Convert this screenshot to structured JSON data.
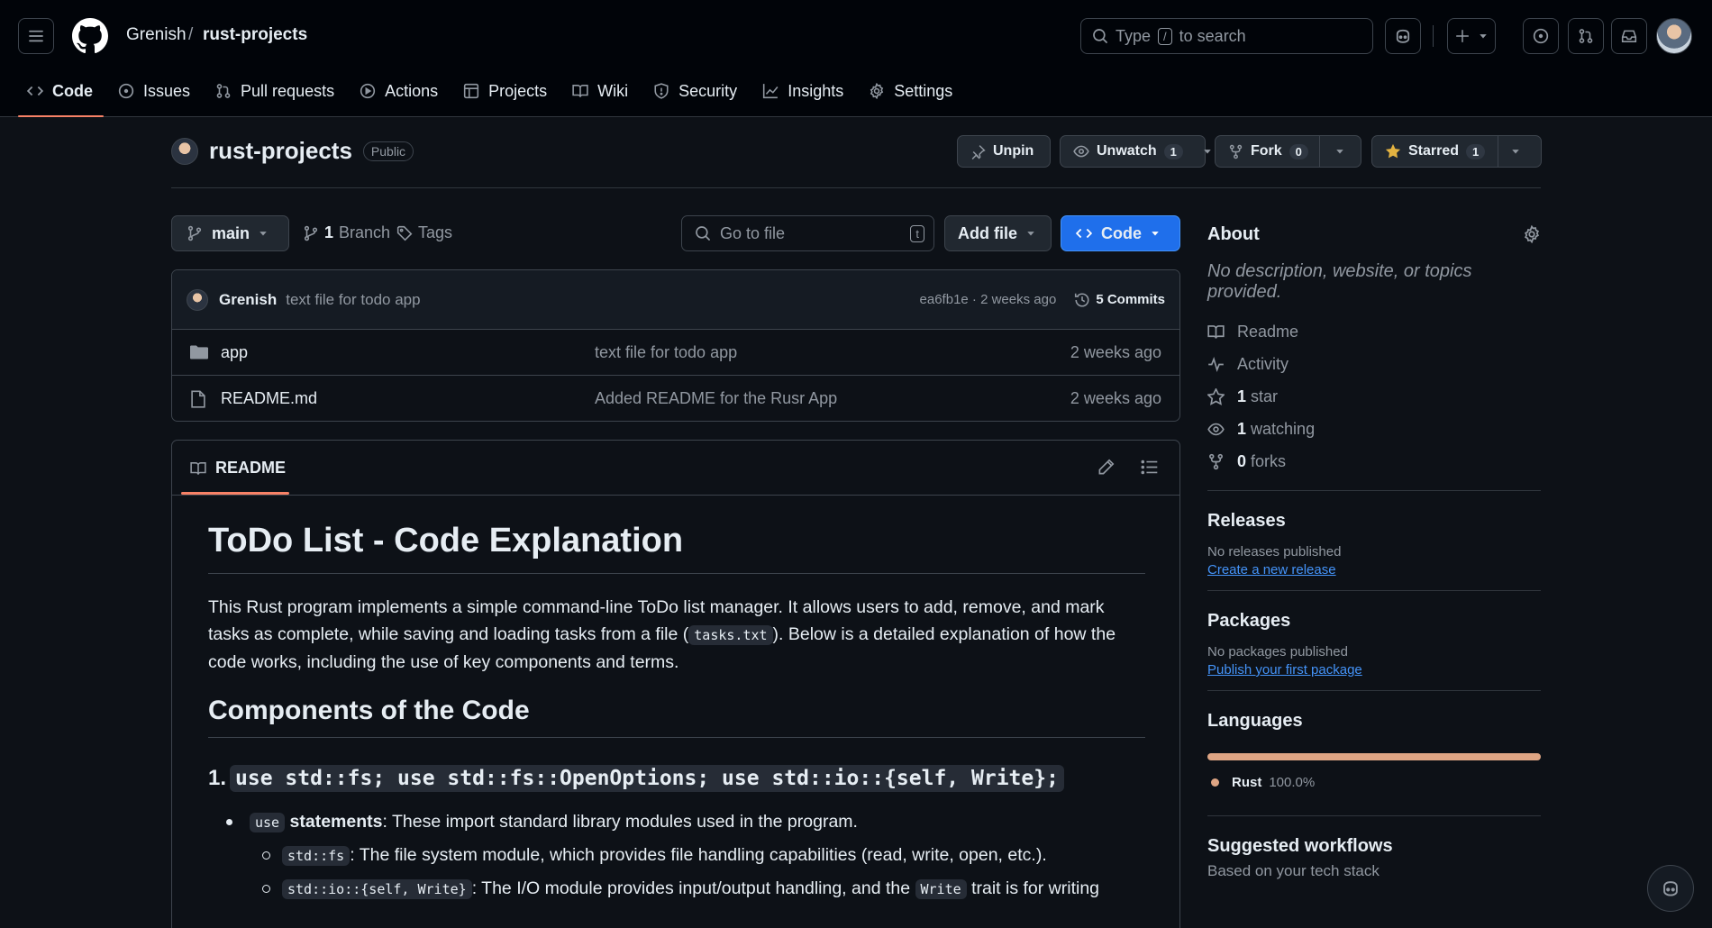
{
  "breadcrumb": {
    "owner": "Grenish",
    "separator": "/",
    "repo": "rust-projects"
  },
  "search": {
    "prefix": "Type",
    "key": "/",
    "suffix": "to search"
  },
  "nav_tabs": [
    {
      "label": "Code",
      "icon": "code-icon",
      "active": true
    },
    {
      "label": "Issues",
      "icon": "issue-icon"
    },
    {
      "label": "Pull requests",
      "icon": "pull-request-icon"
    },
    {
      "label": "Actions",
      "icon": "play-icon"
    },
    {
      "label": "Projects",
      "icon": "table-icon"
    },
    {
      "label": "Wiki",
      "icon": "book-icon"
    },
    {
      "label": "Security",
      "icon": "shield-icon"
    },
    {
      "label": "Insights",
      "icon": "graph-icon"
    },
    {
      "label": "Settings",
      "icon": "gear-icon"
    }
  ],
  "repo": {
    "name": "rust-projects",
    "visibility": "Public"
  },
  "actions": {
    "unpin": "Unpin",
    "unwatch": "Unwatch",
    "watch_count": "1",
    "fork": "Fork",
    "fork_count": "0",
    "starred": "Starred",
    "star_count": "1"
  },
  "toolbar": {
    "branch": "main",
    "branch_count": "1",
    "branch_label": "Branch",
    "tags": "Tags",
    "goto_placeholder": "Go to file",
    "goto_key": "t",
    "add_file": "Add file",
    "code": "Code"
  },
  "latest_commit": {
    "author": "Grenish",
    "message": "text file for todo app",
    "sha_time": "ea6fb1e · 2 weeks ago",
    "commits": "5 Commits"
  },
  "files": [
    {
      "name": "app",
      "type": "folder",
      "message": "text file for todo app",
      "time": "2 weeks ago"
    },
    {
      "name": "README.md",
      "type": "file",
      "message": "Added README for the Rusr App",
      "time": "2 weeks ago"
    }
  ],
  "readme": {
    "tab": "README",
    "h1": "ToDo List - Code Explanation",
    "intro_1": "This Rust program implements a simple command-line ToDo list manager. It allows users to add, remove, and mark tasks as complete, while saving and loading tasks from a file (",
    "intro_code": "tasks.txt",
    "intro_2": "). Below is a detailed explanation of how the code works, including the use of key components and terms.",
    "h2": "Components of the Code",
    "h3_num": "1.",
    "h3_code": "use std::fs; use std::fs::OpenOptions; use std::io::{self, Write};",
    "li1_code": "use",
    "li1_bold": "statements",
    "li1_text": ": These import standard library modules used in the program.",
    "li2a_code": "std::fs",
    "li2a_text": ": The file system module, which provides file handling capabilities (read, write, open, etc.).",
    "li2b_code": "std::io::{self, Write}",
    "li2b_text_1": ": The I/O module provides input/output handling, and the",
    "li2b_code2": "Write",
    "li2b_text_2": "trait is for writing"
  },
  "about": {
    "title": "About",
    "description": "No description, website, or topics provided.",
    "readme": "Readme",
    "activity": "Activity",
    "stars_n": "1",
    "stars": "star",
    "watching_n": "1",
    "watching": "watching",
    "forks_n": "0",
    "forks": "forks"
  },
  "releases": {
    "title": "Releases",
    "none": "No releases published",
    "link": "Create a new release"
  },
  "packages": {
    "title": "Packages",
    "none": "No packages published",
    "link": "Publish your first package"
  },
  "languages": {
    "title": "Languages",
    "name": "Rust",
    "percent": "100.0%",
    "rust_fraction": 1.0,
    "color": "#dea584"
  },
  "workflows": {
    "title": "Suggested workflows",
    "subtitle": "Based on your tech stack"
  },
  "colors": {
    "accent": "#1f6feb",
    "tab_underline": "#f78166",
    "star": "#e3b341",
    "link": "#4493f8"
  }
}
